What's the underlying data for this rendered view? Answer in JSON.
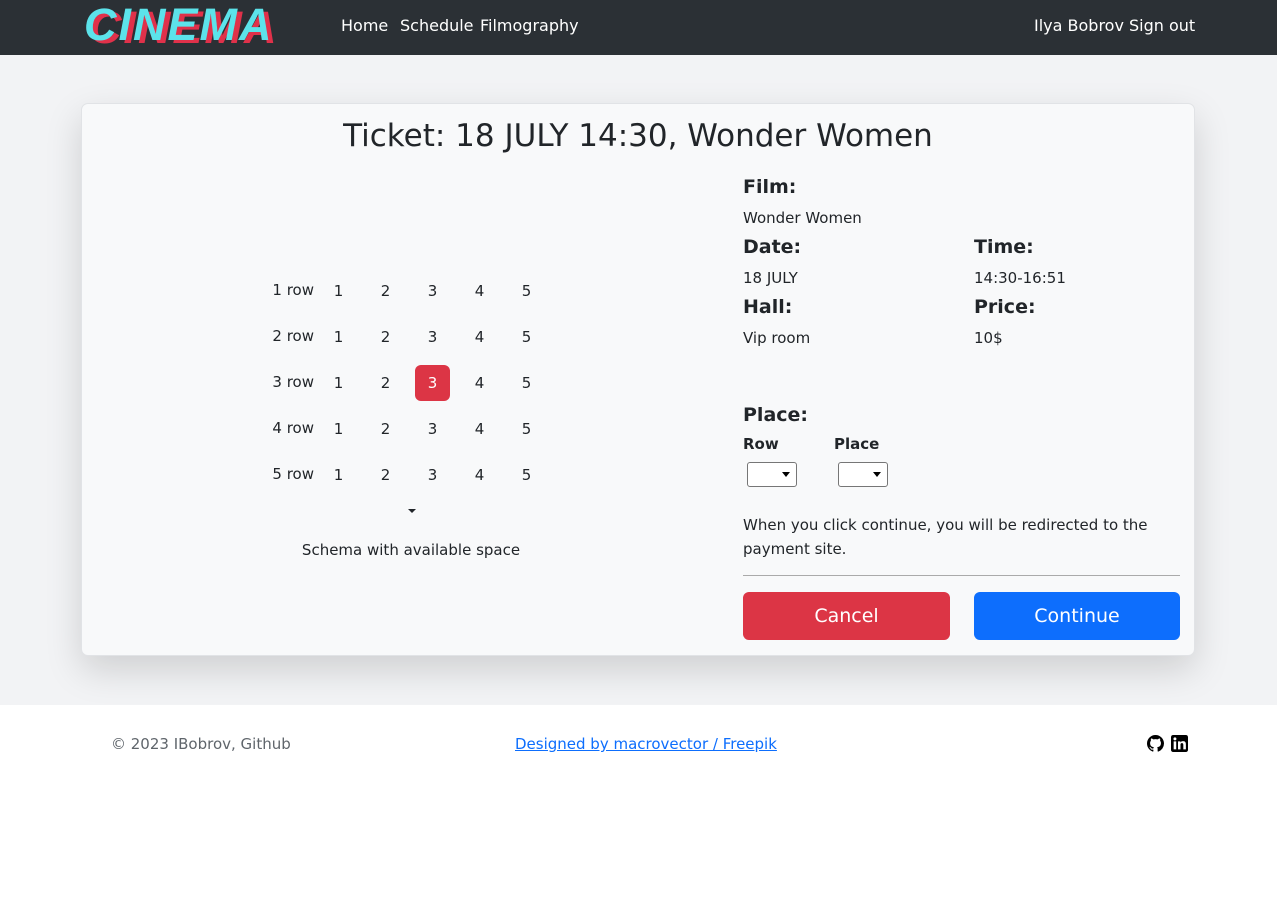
{
  "nav": {
    "logo_text": "CINEMA",
    "links": [
      "Home",
      "Schedule",
      "Filmography"
    ],
    "user": "Ilya Bobrov",
    "signout": "Sign out"
  },
  "ticket": {
    "title": "Ticket: 18 JULY 14:30, Wonder Women",
    "schema": {
      "rows": [
        {
          "label": "1 row",
          "seats": [
            "1",
            "2",
            "3",
            "4",
            "5"
          ]
        },
        {
          "label": "2 row",
          "seats": [
            "1",
            "2",
            "3",
            "4",
            "5"
          ]
        },
        {
          "label": "3 row",
          "seats": [
            "1",
            "2",
            "3",
            "4",
            "5"
          ]
        },
        {
          "label": "4 row",
          "seats": [
            "1",
            "2",
            "3",
            "4",
            "5"
          ]
        },
        {
          "label": "5 row",
          "seats": [
            "1",
            "2",
            "3",
            "4",
            "5"
          ]
        }
      ],
      "selected_row": 3,
      "selected_seat": 3,
      "selected_color": "#dc3545",
      "caption": "Schema with available space"
    },
    "info": {
      "film_label": "Film:",
      "film": "Wonder Women",
      "date_label": "Date:",
      "date": "18 JULY",
      "time_label": "Time:",
      "time": "14:30-16:51",
      "hall_label": "Hall:",
      "hall": "Vip room",
      "price_label": "Price:",
      "price": "10$"
    },
    "place": {
      "label": "Place:",
      "row_label": "Row",
      "place_label": "Place",
      "row_value": "",
      "place_value": ""
    },
    "note": "When you click continue, you will be redirected to the payment site.",
    "cancel": "Cancel",
    "continue": "Continue",
    "cancel_color": "#dc3545",
    "continue_color": "#0d6efd"
  },
  "footer": {
    "copyright": "© 2023 IBobrov, Github",
    "credit_link": "Designed by macrovector / Freepik",
    "icons": [
      "github-icon",
      "linkedin-icon"
    ]
  }
}
